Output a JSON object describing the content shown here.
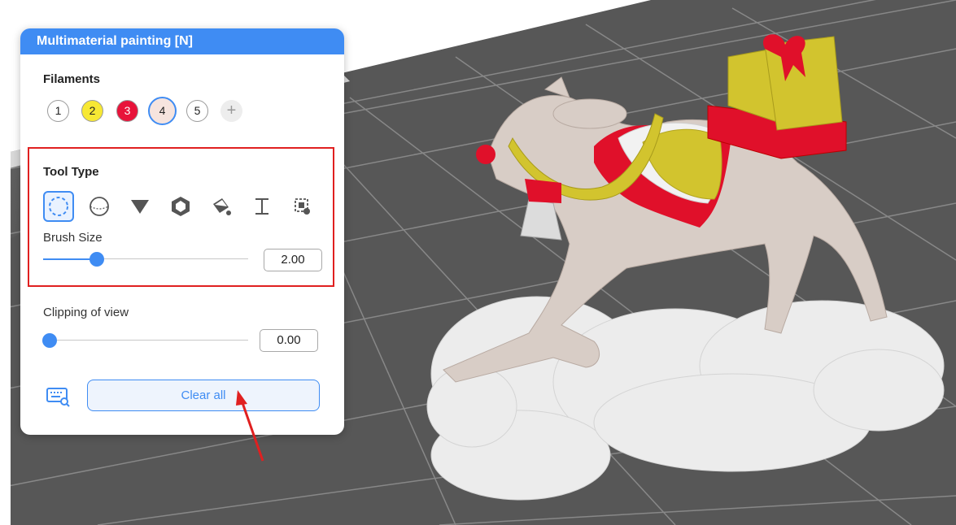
{
  "panel": {
    "title": "Multimaterial painting [N]",
    "filaments_label": "Filaments",
    "filaments": [
      {
        "label": "1",
        "color": "#ffffff"
      },
      {
        "label": "2",
        "color": "#f7e834"
      },
      {
        "label": "3",
        "color": "#e8133a"
      },
      {
        "label": "4",
        "color": "#f6e4de",
        "selected": true
      },
      {
        "label": "5",
        "color": "#ffffff"
      }
    ],
    "add_filament_label": "+",
    "tool_type_label": "Tool Type",
    "tools": [
      {
        "name": "circle-brush",
        "active": true
      },
      {
        "name": "sphere-brush"
      },
      {
        "name": "triangle-brush"
      },
      {
        "name": "fill-hexagon"
      },
      {
        "name": "bucket-fill"
      },
      {
        "name": "gap-fill"
      },
      {
        "name": "smart-fill"
      }
    ],
    "brush_size_label": "Brush Size",
    "brush_size_value": "2.00",
    "brush_size_fraction": 0.26,
    "clipping_label": "Clipping of view",
    "clipping_value": "0.00",
    "clipping_fraction": 0.0,
    "clear_all_label": "Clear all"
  },
  "colors": {
    "accent": "#3f8cf3",
    "highlight_border": "#e02020",
    "model_body": "#d8cdc6",
    "model_red": "#e0102a",
    "model_yellow": "#d2c42e",
    "cloud": "#eeeeee"
  }
}
